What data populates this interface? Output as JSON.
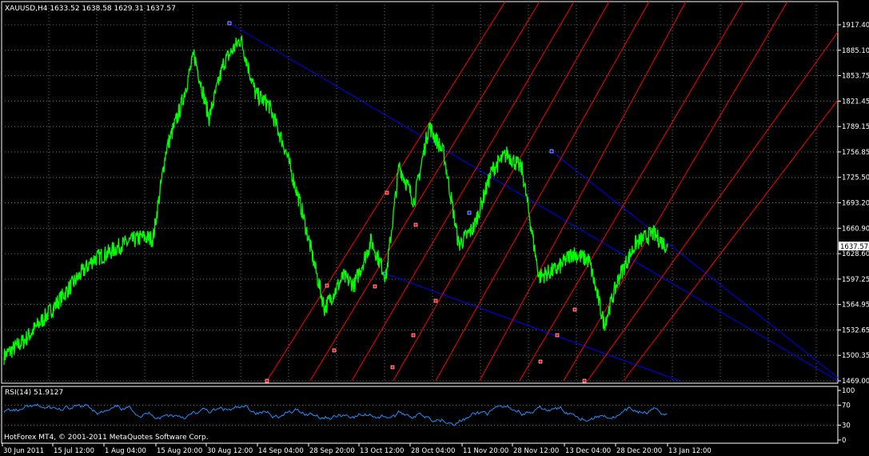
{
  "window": {
    "symbol_header": "XAUUSD,H4  1633.52 1638.58 1629.31 1637.57",
    "current_price": "1637.57",
    "copyright": "HotForex MT4, © 2001-2011 MetaQuotes Software Corp.",
    "rsi_header": "RSI(14) 51.9127"
  },
  "colors": {
    "background": "#000000",
    "grid": "#6b6b6b",
    "price_line": "#00ff00",
    "channel_blue": "#0000ff",
    "channel_red": "#ff0000",
    "rsi_line": "#1e90ff",
    "text": "#ffffff"
  },
  "chart_data": [
    {
      "type": "line",
      "title": "XAUUSD,H4",
      "price_axis_ticks": [
        "1917.40",
        "1885.10",
        "1853.75",
        "1821.45",
        "1789.15",
        "1756.85",
        "1725.50",
        "1693.20",
        "1660.90",
        "1628.60",
        "1597.25",
        "1564.95",
        "1532.65",
        "1500.35",
        "1469.00"
      ],
      "time_axis_ticks": [
        "30 Jun 2011",
        "15 Jul 12:00",
        "1 Aug 04:00",
        "15 Aug 20:00",
        "30 Aug 12:00",
        "14 Sep 04:00",
        "28 Sep 20:00",
        "13 Oct 12:00",
        "28 Oct 04:00",
        "11 Nov 20:00",
        "28 Nov 12:00",
        "13 Dec 04:00",
        "28 Dec 20:00",
        "13 Jan 12:00"
      ],
      "ylim": [
        1469.0,
        1917.4
      ],
      "series": [
        {
          "key_points_index": [
            0,
            11,
            26,
            40,
            48,
            56,
            63,
            74,
            80,
            87,
            95,
            102,
            110,
            118,
            127,
            135,
            142,
            151,
            160,
            172,
            182,
            188,
            197,
            205,
            212,
            220,
            228,
            236,
            244,
            252,
            262,
            270,
            278,
            287,
            297,
            305,
            314,
            322,
            330,
            339,
            348,
            356
          ],
          "key_points_price": [
            1500,
            1520,
            1560,
            1600,
            1622,
            1630,
            1640,
            1650,
            1648,
            1760,
            1815,
            1880,
            1800,
            1870,
            1900,
            1830,
            1817,
            1760,
            1682,
            1560,
            1600,
            1590,
            1645,
            1600,
            1740,
            1695,
            1790,
            1755,
            1640,
            1662,
            1735,
            1755,
            1735,
            1600,
            1610,
            1630,
            1620,
            1540,
            1600,
            1642,
            1655,
            1637.57
          ],
          "grid": true
        }
      ],
      "channel_points": {
        "blue": [
          [
            1910.4,
            1533.6
          ]
        ],
        "pivot_labels": []
      }
    },
    {
      "type": "line",
      "title": "RSI(14) 51.9127",
      "ylim": [
        0,
        100
      ],
      "ticks": [
        "100",
        "70",
        "30",
        "0"
      ],
      "value_last": 51.9127
    }
  ]
}
